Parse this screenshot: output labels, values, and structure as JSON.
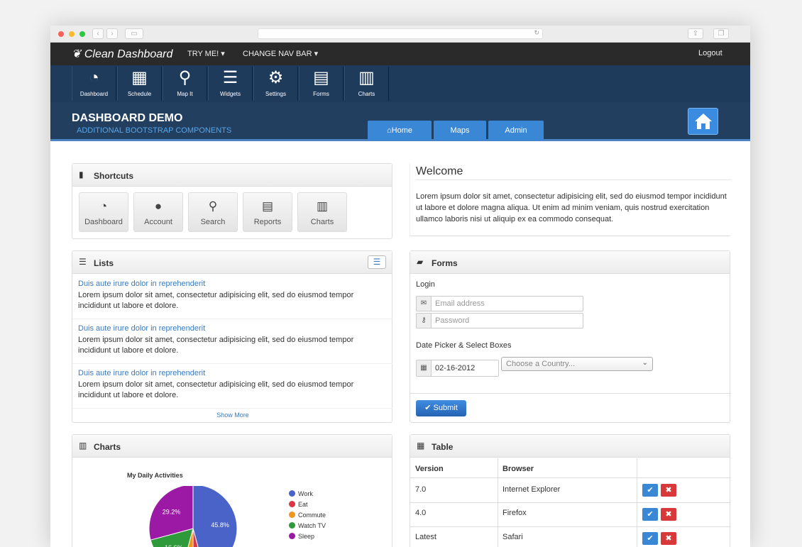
{
  "brand": "Clean Dashboard",
  "topnav": {
    "try_me": "TRY ME! ▾",
    "change_nav": "CHANGE NAV BAR ▾",
    "logout": "Logout"
  },
  "iconbar": [
    {
      "label": "Dashboard",
      "icon": "dashboard-icon"
    },
    {
      "label": "Schedule",
      "icon": "calendar-icon"
    },
    {
      "label": "Map It",
      "icon": "map-pin-icon"
    },
    {
      "label": "Widgets",
      "icon": "widgets-icon"
    },
    {
      "label": "Settings",
      "icon": "gears-icon"
    },
    {
      "label": "Forms",
      "icon": "form-icon"
    },
    {
      "label": "Charts",
      "icon": "bar-chart-icon"
    }
  ],
  "header": {
    "title": "DASHBOARD DEMO",
    "subtitle": "ADDITIONAL BOOTSTRAP COMPONENTS",
    "tabs": [
      "Home",
      "Maps",
      "Admin"
    ]
  },
  "shortcuts": {
    "title": "Shortcuts",
    "items": [
      "Dashboard",
      "Account",
      "Search",
      "Reports",
      "Charts"
    ]
  },
  "welcome": {
    "title": "Welcome",
    "text": "Lorem ipsum dolor sit amet, consectetur adipisicing elit, sed do eiusmod tempor incididunt ut labore et dolore magna aliqua. Ut enim ad minim veniam, quis nostrud exercitation ullamco laboris nisi ut aliquip ex ea commodo consequat."
  },
  "lists": {
    "title": "Lists",
    "items": [
      {
        "title": "Duis aute irure dolor in reprehenderit",
        "text": "Lorem ipsum dolor sit amet, consectetur adipisicing elit, sed do eiusmod tempor incididunt ut labore et dolore."
      },
      {
        "title": "Duis aute irure dolor in reprehenderit",
        "text": "Lorem ipsum dolor sit amet, consectetur adipisicing elit, sed do eiusmod tempor incididunt ut labore et dolore."
      },
      {
        "title": "Duis aute irure dolor in reprehenderit",
        "text": "Lorem ipsum dolor sit amet, consectetur adipisicing elit, sed do eiusmod tempor incididunt ut labore et dolore."
      }
    ],
    "show_more": "Show More"
  },
  "forms": {
    "title": "Forms",
    "login_label": "Login",
    "email_placeholder": "Email address",
    "password_placeholder": "Password",
    "date_label": "Date Picker & Select Boxes",
    "date_value": "02-16-2012",
    "country_placeholder": "Choose a Country...",
    "submit": "Submit"
  },
  "charts_panel": {
    "title": "Charts"
  },
  "chart_data": {
    "type": "pie",
    "title": "My Daily Activities",
    "categories": [
      "Work",
      "Eat",
      "Commute",
      "Watch TV",
      "Sleep"
    ],
    "values": [
      45.8,
      4.2,
      4.2,
      16.6,
      29.2
    ],
    "colors": [
      "#4a63c8",
      "#dc3545",
      "#f0961e",
      "#2e9a3a",
      "#9b19a5"
    ]
  },
  "table": {
    "title": "Table",
    "headers": [
      "Version",
      "Browser"
    ],
    "rows": [
      [
        "7.0",
        "Internet Explorer"
      ],
      [
        "4.0",
        "Firefox"
      ],
      [
        "Latest",
        "Safari"
      ]
    ]
  }
}
